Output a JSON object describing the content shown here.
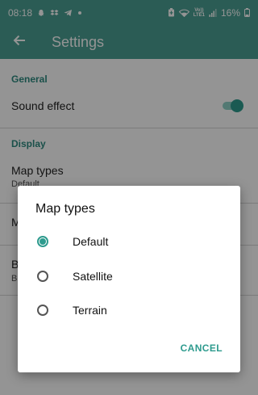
{
  "status_bar": {
    "time": "08:18",
    "battery": "16%",
    "volte_top": "Vo))",
    "volte_bottom": "LTE1",
    "icons": [
      "snapchat-icon",
      "dropbox-icon",
      "telegram-icon",
      "dot-icon",
      "battery-saver-icon",
      "wifi-icon",
      "volte-icon",
      "signal-icon",
      "battery-icon"
    ]
  },
  "app_bar": {
    "title": "Settings",
    "back_icon": "arrow-back-icon"
  },
  "sections": {
    "general": {
      "header": "General",
      "sound_effect": {
        "title": "Sound effect",
        "enabled": true
      }
    },
    "display": {
      "header": "Display",
      "map_types": {
        "title": "Map types",
        "summary": "Default"
      },
      "row2_title": "M",
      "row3_title": "B",
      "row3_summary": "B"
    }
  },
  "dialog": {
    "title": "Map types",
    "options": [
      {
        "label": "Default",
        "selected": true
      },
      {
        "label": "Satellite",
        "selected": false
      },
      {
        "label": "Terrain",
        "selected": false
      }
    ],
    "cancel_label": "CANCEL"
  },
  "colors": {
    "primary": "#4b9f93",
    "accent": "#2e9b8e"
  }
}
